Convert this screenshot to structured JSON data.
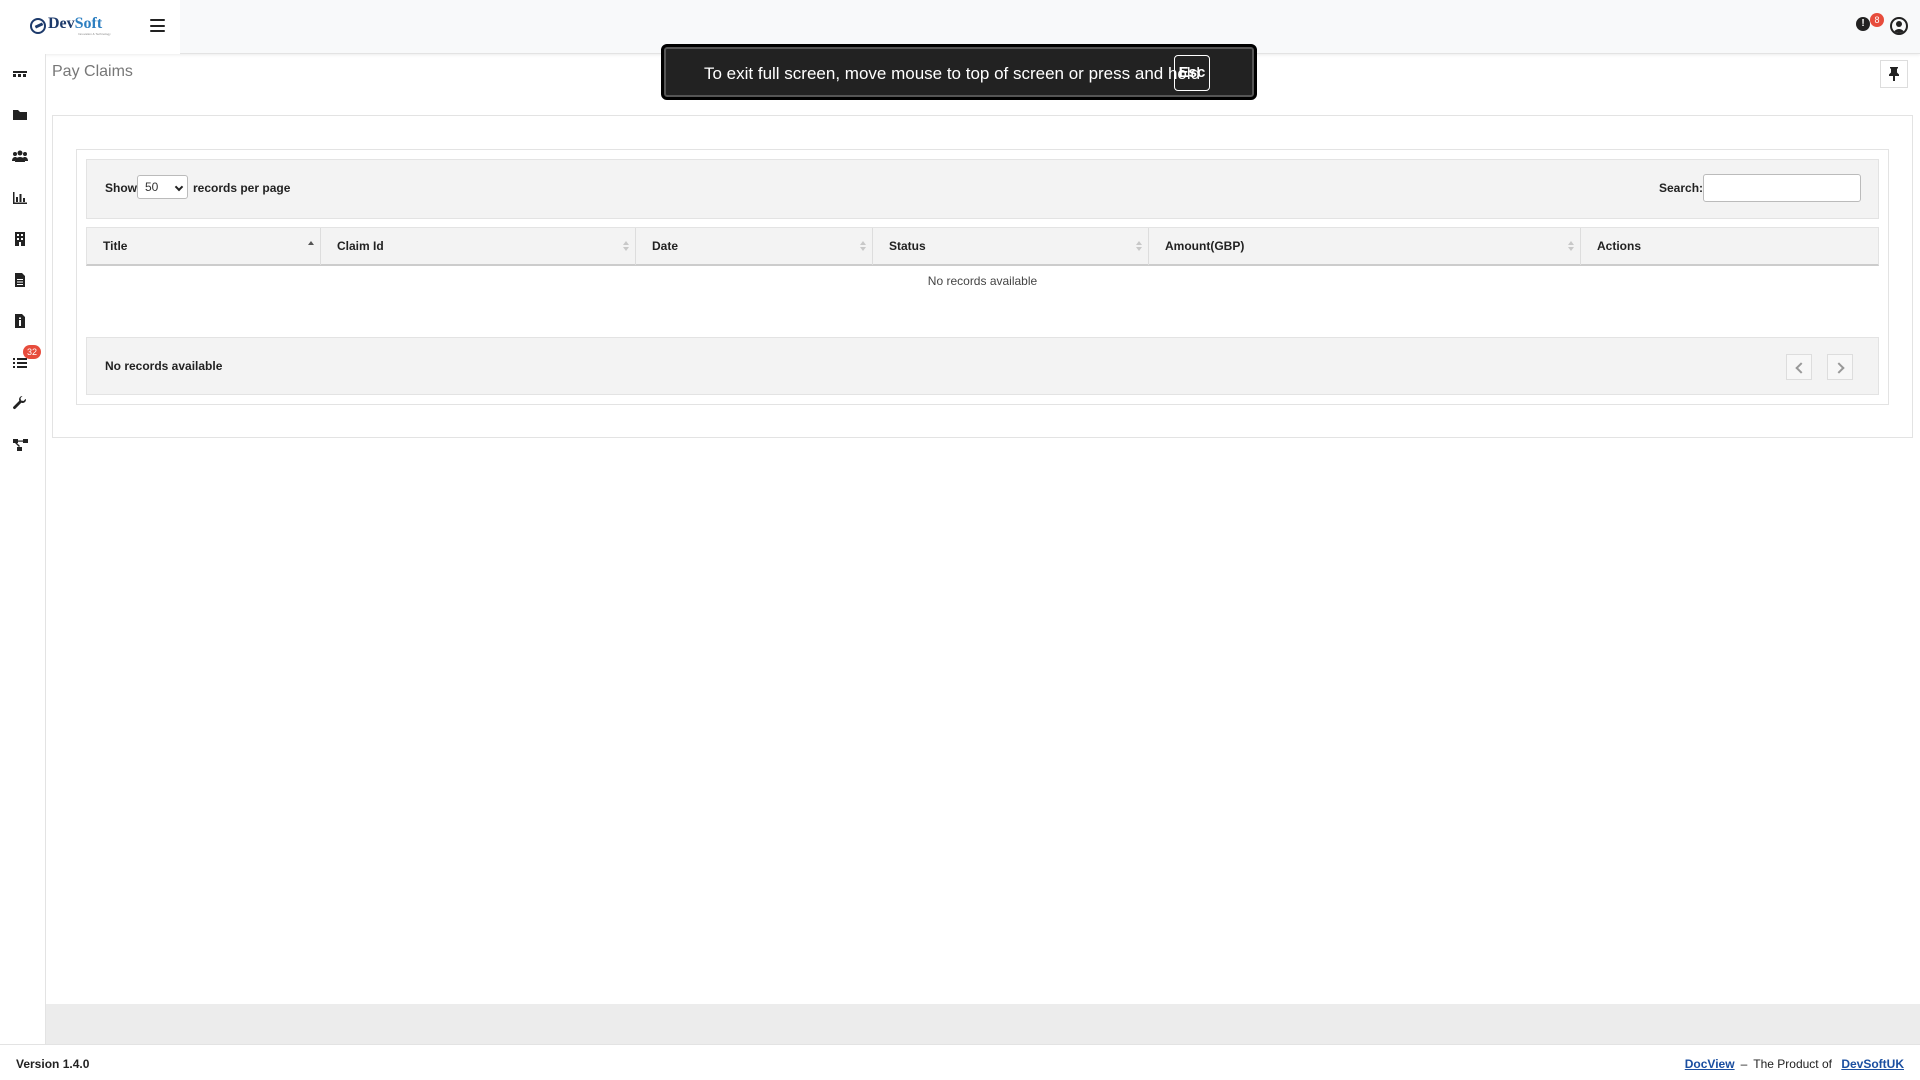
{
  "app": {
    "logo_dev": "Dev",
    "logo_soft": "Soft",
    "logo_tagline": "Innovation & Technology",
    "notifications_count": "8"
  },
  "sidebar": {
    "items": [
      {
        "name": "dashboard",
        "icon": "dashboard-icon"
      },
      {
        "name": "folders",
        "icon": "folder-icon"
      },
      {
        "name": "users",
        "icon": "users-icon"
      },
      {
        "name": "reports",
        "icon": "bar-chart-icon"
      },
      {
        "name": "buildings",
        "icon": "building-icon"
      },
      {
        "name": "documents",
        "icon": "document-icon"
      },
      {
        "name": "file-info",
        "icon": "file-info-icon"
      },
      {
        "name": "tasks",
        "icon": "task-list-icon",
        "badge": "32"
      },
      {
        "name": "tools",
        "icon": "wrench-icon"
      },
      {
        "name": "workflow",
        "icon": "workflow-icon"
      }
    ]
  },
  "page": {
    "title": "Pay Claims"
  },
  "table_controls": {
    "show_label": "Show",
    "page_size": "50",
    "per_page_label": "records per page",
    "search_label": "Search:",
    "search_value": ""
  },
  "table": {
    "columns": [
      "Title",
      "Claim Id",
      "Date",
      "Status",
      "Amount(GBP)",
      "Actions"
    ],
    "sorted_column": "Title",
    "sort_direction": "ascending",
    "empty_message": "No records available",
    "info_text": "No records available"
  },
  "footer": {
    "version": "Version 1.4.0",
    "link_docview": "DocView",
    "separator": "–",
    "product_text": "The Product of",
    "link_company": "DevSoftUK"
  },
  "fullscreen_notice": {
    "text": "To exit full screen, move mouse to top of screen or press and hold",
    "key": "Esc"
  },
  "colors": {
    "accent_blue": "#2d7fc1",
    "badge_red": "#e74c3c",
    "link_blue": "#1a4ea0"
  }
}
